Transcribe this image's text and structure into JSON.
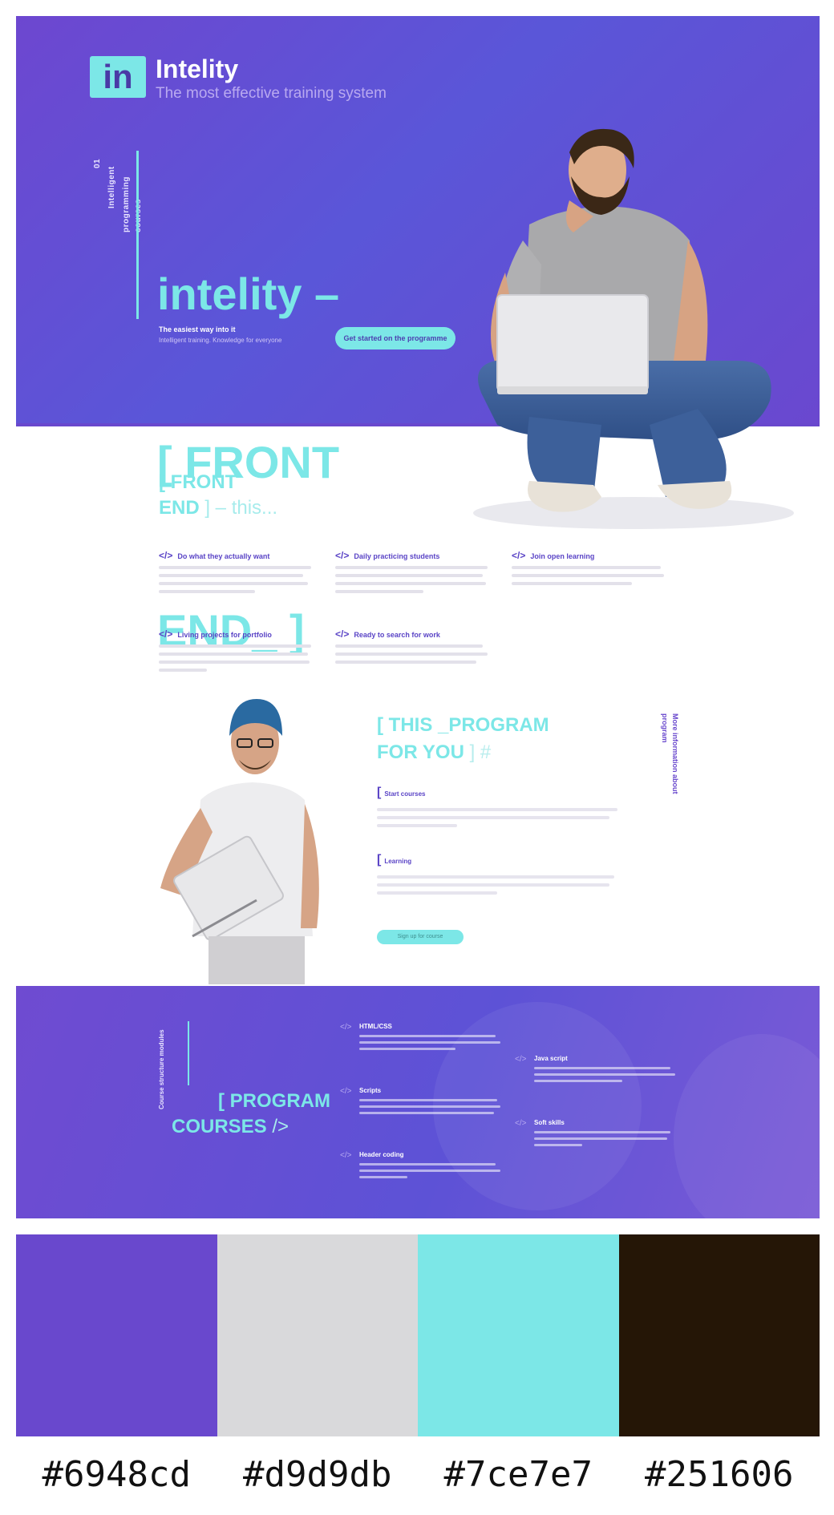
{
  "brand": {
    "logo_mark": "in",
    "name": "Intelity",
    "tagline": "The most effective training system"
  },
  "hero": {
    "title_line1": "intelity –",
    "title_line2": "[ FRONT",
    "title_line3": "END_ ]",
    "sub_line1": "The easiest way into it",
    "sub_line2": "Intelligent training. Knowledge for everyone",
    "cta": "Get started on the programme"
  },
  "hero_vertical": {
    "col1": "01",
    "col2": "Intelligent",
    "col3": "programming courses"
  },
  "section2": {
    "title_line1": "[ FRONT",
    "title_line2": "END",
    "title_suffix": "] – this...",
    "features": [
      {
        "code": "</>",
        "title": "Do what they actually want"
      },
      {
        "code": "</>",
        "title": "Daily practicing students"
      },
      {
        "code": "</>",
        "title": "Join open learning"
      },
      {
        "code": "</>",
        "title": "Living projects for portfolio"
      },
      {
        "code": "</>",
        "title": "Ready to search for work"
      }
    ]
  },
  "program": {
    "title_line1": "[ THIS _PROGRAM",
    "title_line2": "FOR YOU",
    "title_suffix": "] #",
    "vertical": "More information about program",
    "items": [
      {
        "bracket": "[",
        "title": "Start courses"
      },
      {
        "bracket": "[",
        "title": "Learning"
      }
    ],
    "cta": "Sign up for course"
  },
  "courses": {
    "title_line1": "[ PROGRAM",
    "title_line2": "COURSES",
    "title_suffix": "/>",
    "vertical": "Course structure modules",
    "items": [
      {
        "icon": "</>",
        "title": "HTML/CSS"
      },
      {
        "icon": "</>",
        "title": "Scripts"
      },
      {
        "icon": "</>",
        "title": "Header coding"
      },
      {
        "icon": "</>",
        "title": "Java script"
      },
      {
        "icon": "</>",
        "title": "Soft skills"
      }
    ]
  },
  "palette": [
    {
      "hex": "#6948cd"
    },
    {
      "hex": "#d9d9db"
    },
    {
      "hex": "#7ce7e7"
    },
    {
      "hex": "#251606"
    }
  ],
  "colors": {
    "primary": "#6948cd",
    "light_gray": "#d9d9db",
    "accent": "#7ce7e7",
    "dark": "#251606"
  }
}
